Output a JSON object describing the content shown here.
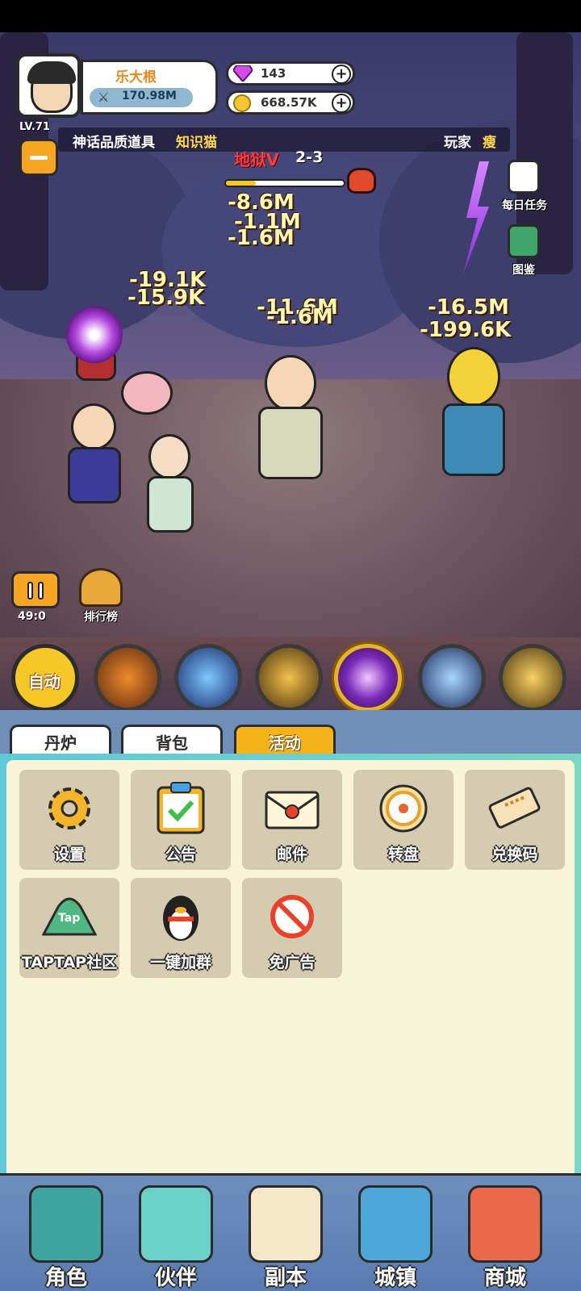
{
  "player": {
    "name": "乐大根",
    "level": "LV.71",
    "power": "170.98M"
  },
  "resources": {
    "gems": "143",
    "coins": "668.57K"
  },
  "marquee": {
    "prefix": "神话品质道具",
    "item_owner": "知识猫",
    "player_label": "玩家",
    "player_name": "瘦"
  },
  "stage": {
    "title": "地狱V",
    "number": "2-3",
    "progress_fraction": 0.25
  },
  "side_menu": {
    "daily_tasks": "每日任务",
    "encyclopedia": "图鉴"
  },
  "damage_numbers": [
    "-8.6M",
    "-1.1M",
    "-1.6M",
    "-19.1K",
    "-15.9K",
    "-11.6M",
    "-1.6M",
    "-16.5M",
    "-199.6K"
  ],
  "battle_controls": {
    "timer": "49:0",
    "leaderboard": "排行榜"
  },
  "skills": {
    "auto_label": "自动",
    "icons": [
      "muscle-skill-icon",
      "blue-fire-skill-icon",
      "lightning-skill-icon",
      "purple-orb-skill-icon",
      "ice-card-skill-icon",
      "gold-swords-skill-icon"
    ],
    "active_index": 3
  },
  "tabs": [
    "丹炉",
    "背包",
    "活动"
  ],
  "selected_tab": "活动",
  "activity_grid": [
    {
      "label": "设置",
      "icon": "gear-icon"
    },
    {
      "label": "公告",
      "icon": "clipboard-check-icon"
    },
    {
      "label": "邮件",
      "icon": "envelope-icon"
    },
    {
      "label": "转盘",
      "icon": "wheel-icon"
    },
    {
      "label": "兑换码",
      "icon": "ticket-icon"
    },
    {
      "label": "TAPTAP社区",
      "icon": "taptap-icon"
    },
    {
      "label": "一键加群",
      "icon": "penguin-icon"
    },
    {
      "label": "免广告",
      "icon": "no-ads-icon"
    }
  ],
  "bottom_nav": [
    "角色",
    "伙伴",
    "副本",
    "城镇",
    "商城"
  ],
  "colors": {
    "accent_orange": "#f6a623",
    "panel_bg": "#f8f4d8",
    "tab_selected": "#f5b31a"
  }
}
